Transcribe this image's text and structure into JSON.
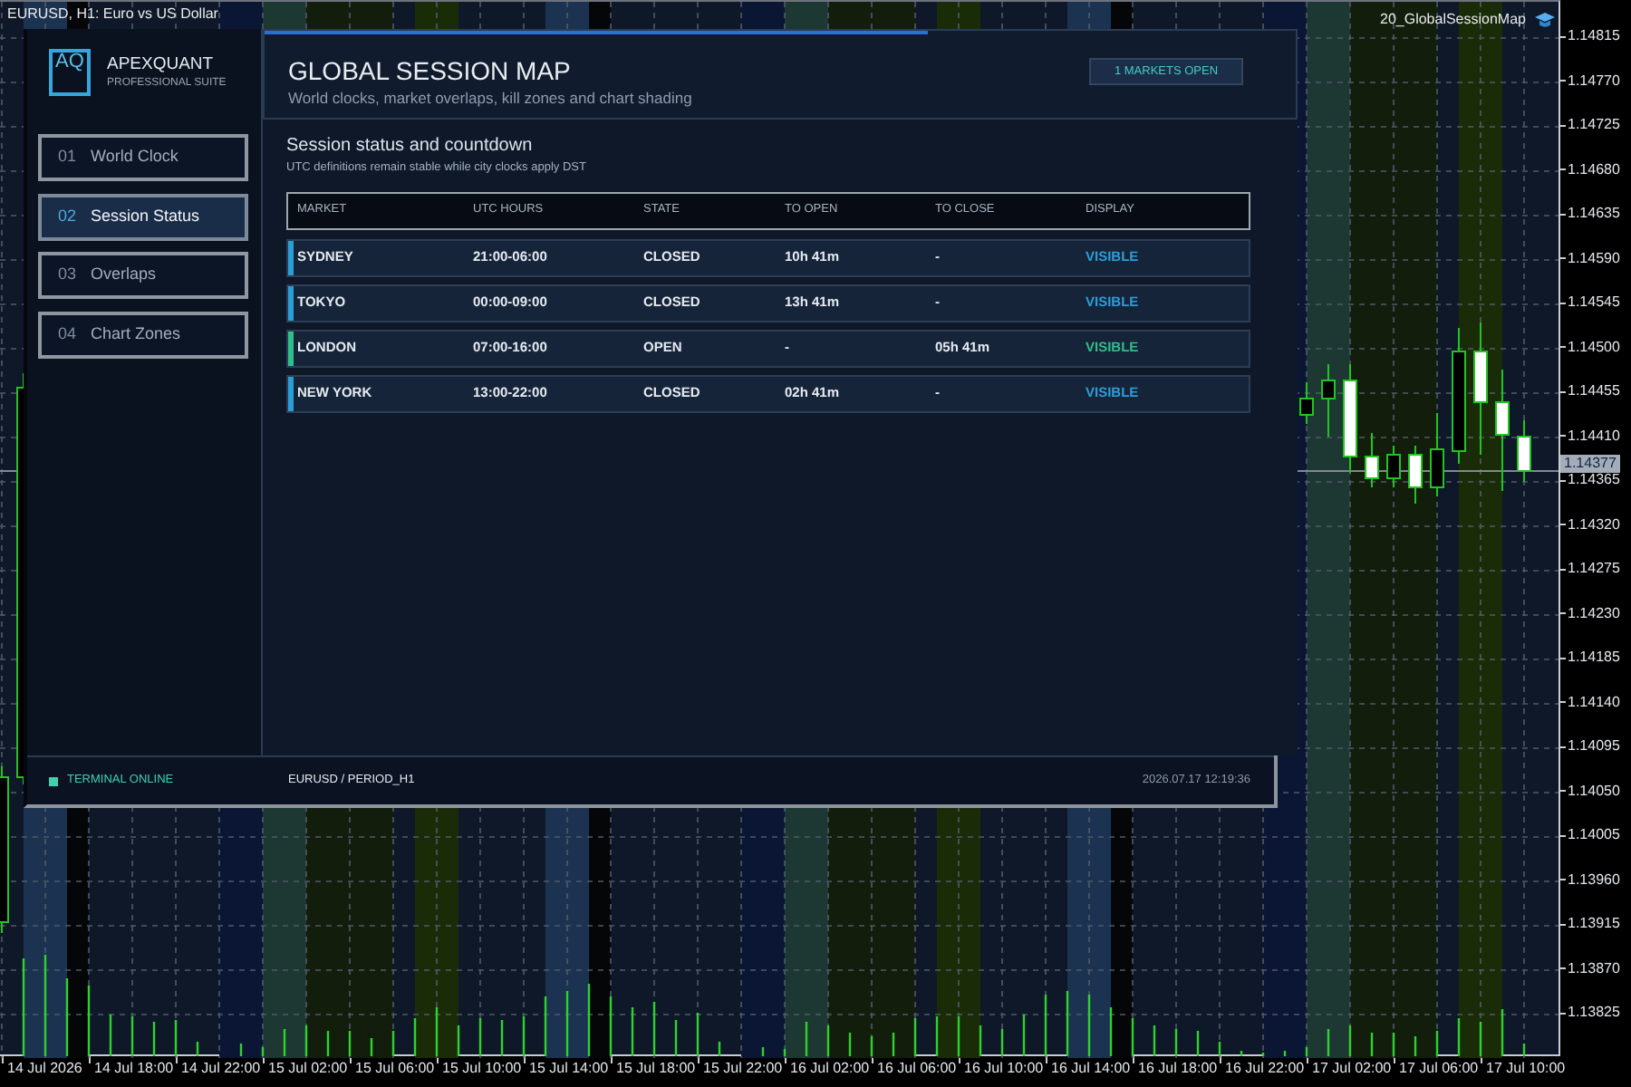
{
  "chart": {
    "symbol": "EURUSD, H1: Euro vs US Dollar",
    "indicator": "20_GlobalSessionMap",
    "price_scale": [
      "1.14815",
      "1.14770",
      "1.14725",
      "1.14680",
      "1.14635",
      "1.14590",
      "1.14545",
      "1.14500",
      "1.14455",
      "1.14410",
      "1.14365",
      "1.14320",
      "1.14275",
      "1.14230",
      "1.14185",
      "1.14140",
      "1.14095",
      "1.14050",
      "1.14005",
      "1.13960",
      "1.13915",
      "1.13870",
      "1.13825"
    ],
    "current_price": "1.14377",
    "time_scale": [
      "14 Jul 2026",
      "14 Jul 18:00",
      "14 Jul 22:00",
      "15 Jul 02:00",
      "15 Jul 06:00",
      "15 Jul 10:00",
      "15 Jul 14:00",
      "15 Jul 18:00",
      "15 Jul 22:00",
      "16 Jul 02:00",
      "16 Jul 06:00",
      "16 Jul 10:00",
      "16 Jul 14:00",
      "16 Jul 18:00",
      "16 Jul 22:00",
      "17 Jul 02:00",
      "17 Jul 06:00",
      "17 Jul 10:00"
    ]
  },
  "panel": {
    "brand": {
      "logo": "AQ",
      "name": "APEXQUANT",
      "tagline": "PROFESSIONAL SUITE"
    },
    "nav": [
      {
        "number": "01",
        "label": "World Clock",
        "selected": false
      },
      {
        "number": "02",
        "label": "Session Status",
        "selected": true
      },
      {
        "number": "03",
        "label": "Overlaps",
        "selected": false
      },
      {
        "number": "04",
        "label": "Chart Zones",
        "selected": false
      }
    ],
    "header": {
      "title": "GLOBAL SESSION MAP",
      "subtitle": "World clocks, market overlaps, kill zones and chart shading",
      "badge": "1 MARKETS OPEN"
    },
    "section": {
      "title": "Session status and countdown",
      "note": "UTC definitions remain stable while city clocks apply DST"
    },
    "table": {
      "columns": [
        "MARKET",
        "UTC HOURS",
        "STATE",
        "TO OPEN",
        "TO CLOSE",
        "DISPLAY"
      ],
      "rows": [
        {
          "market": "SYDNEY",
          "utc_hours": "21:00-06:00",
          "state": "CLOSED",
          "to_open": "10h 41m",
          "to_close": "-",
          "display": "VISIBLE",
          "color": "#2a9fd6"
        },
        {
          "market": "TOKYO",
          "utc_hours": "00:00-09:00",
          "state": "CLOSED",
          "to_open": "13h 41m",
          "to_close": "-",
          "display": "VISIBLE",
          "color": "#2a9fd6"
        },
        {
          "market": "LONDON",
          "utc_hours": "07:00-16:00",
          "state": "OPEN",
          "to_open": "-",
          "to_close": "05h 41m",
          "display": "VISIBLE",
          "color": "#2fbf8a"
        },
        {
          "market": "NEW YORK",
          "utc_hours": "13:00-22:00",
          "state": "CLOSED",
          "to_open": "02h 41m",
          "to_close": "-",
          "display": "VISIBLE",
          "color": "#2a9fd6"
        }
      ]
    },
    "status_bar": {
      "status": "TERMINAL ONLINE",
      "symbol": "EURUSD / PERIOD_H1",
      "time": "2026.07.17 12:19:36"
    }
  }
}
